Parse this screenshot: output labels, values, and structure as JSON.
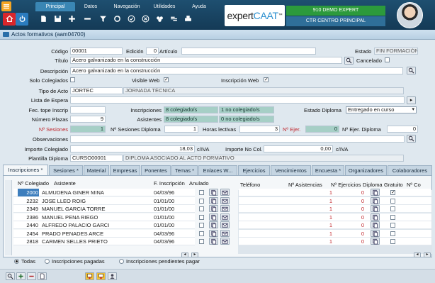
{
  "menu": {
    "tabs": [
      "Principal",
      "Datos",
      "Navegación",
      "Utilidades",
      "Ayuda"
    ],
    "active_tab": "Principal",
    "toolbar_icons": [
      "home-icon",
      "new-document-icon",
      "save-icon",
      "add-icon",
      "delete-icon",
      "filter-icon",
      "refresh-icon",
      "check-icon",
      "close-icon",
      "group-icon",
      "link-icon",
      "print-icon"
    ]
  },
  "brand": {
    "logo_part1": "expert",
    "logo_part2": "CAAT",
    "logo_trademark": "™"
  },
  "user": {
    "company": "910 DEMO EXPERT",
    "center": "CTR CENTRO PRINCIPAL"
  },
  "window": {
    "title": "Actos formativos (aam04700)"
  },
  "form": {
    "codigo_label": "Código",
    "codigo_value": "00001",
    "edicion_label": "Edición",
    "edicion_value": "0",
    "articulo_label": "Artículo",
    "articulo_value": "",
    "estado_label": "Estado",
    "estado_value": "FIN FORMACIÓN",
    "titulo_label": "Título",
    "titulo_value": "Acero galvanizado en la construcción",
    "cancelado_label": "Cancelado",
    "descripcion_label": "Descripción",
    "descripcion_value": "Acero galvanizado en la construcción",
    "solo_colegiados_label": "Solo Colegiados",
    "visible_web_label": "Visible Web",
    "inscripcion_web_label": "Inscripción Web",
    "tipo_acto_label": "Tipo de Acto",
    "tipo_acto_code": "JORTEC",
    "tipo_acto_desc": "JORNADA TÉCNICA",
    "lista_espera_label": "Lista de Espera",
    "fec_tope_label": "Fec. tope Inscrip",
    "inscripciones_label": "Inscripciones",
    "inscripciones_col": "8 colegiado/s",
    "inscripciones_nocol": "1 no colegiado/s",
    "estado_diploma_label": "Estado Diploma",
    "estado_diploma_value": "Entregado en curso",
    "numero_plazas_label": "Número Plazas",
    "numero_plazas_value": "9",
    "asistentes_label": "Asistentes",
    "asistentes_col": "8 colegiado/s",
    "asistentes_nocol": "0 no colegiado/s",
    "n_sesiones_label": "Nº Sesiones",
    "n_sesiones_value": "1",
    "n_sesiones_diploma_label": "Nº Sesiones Diploma",
    "n_sesiones_diploma_value": "1",
    "horas_lectivas_label": "Horas lectivas",
    "horas_lectivas_value": "3",
    "n_ejer_label": "Nº Ejer.",
    "n_ejer_value": "0",
    "n_ejer_diploma_label": "Nº Ejer. Diploma",
    "n_ejer_diploma_value": "0",
    "observaciones_label": "Observaciones",
    "importe_colegiado_label": "Importe Colegiado",
    "importe_colegiado_value": "18,03",
    "importe_colegiado_iva": "c/IVA",
    "importe_nocol_label": "Importe No Col.",
    "importe_nocol_value": "0,00",
    "importe_nocol_iva": "c/IVA",
    "plantilla_label": "Plantilla Diploma",
    "plantilla_code": "CURSO00001",
    "plantilla_desc": "DIPLOMA ASOCIADO AL ACTO FORMATIVO"
  },
  "tabs": [
    "Inscripciones *",
    "Sesiones *",
    "Material",
    "Empresas",
    "Ponentes",
    "Temas *",
    "Enlaces W...",
    "Ejercicios",
    "Vencimientos",
    "Encuesta *",
    "Organizadores",
    "Colaboradores"
  ],
  "grid": {
    "columns": {
      "colegiado": "Nº Colegiado",
      "asistente": "Asistente",
      "f_inscripcion": "F. Inscripción",
      "anulado": "Anulado",
      "telefono": "Teléfono",
      "n_asistencias": "Nº Asistencias",
      "n_ejercicios": "Nº Ejercicios",
      "diploma": "Diploma",
      "gratuito": "Gratuito",
      "n_co": "Nº Co"
    },
    "rows": [
      {
        "colegiado": "2000",
        "asistente": "ALMUDENA GINER MINA",
        "fecha": "04/03/96",
        "asistencias": "1",
        "ejercicios": "0",
        "gratuito": true
      },
      {
        "colegiado": "2232",
        "asistente": "JOSE LLEO ROIG",
        "fecha": "01/01/00",
        "asistencias": "1",
        "ejercicios": "0",
        "gratuito": false
      },
      {
        "colegiado": "2349",
        "asistente": "MANUEL GARCIA TORRE",
        "fecha": "01/01/00",
        "asistencias": "1",
        "ejercicios": "0",
        "gratuito": false
      },
      {
        "colegiado": "2386",
        "asistente": "MANUEL PENA RIEGO",
        "fecha": "01/01/00",
        "asistencias": "1",
        "ejercicios": "0",
        "gratuito": false
      },
      {
        "colegiado": "2440",
        "asistente": "ALFREDO PALACIO GARCI",
        "fecha": "01/01/00",
        "asistencias": "1",
        "ejercicios": "0",
        "gratuito": false
      },
      {
        "colegiado": "2454",
        "asistente": "PRADO PENADES ARCE",
        "fecha": "04/03/96",
        "asistencias": "1",
        "ejercicios": "0",
        "gratuito": false
      },
      {
        "colegiado": "2818",
        "asistente": "CARMEN SELLES PRIETO",
        "fecha": "04/03/96",
        "asistencias": "1",
        "ejercicios": "0",
        "gratuito": false
      }
    ]
  },
  "filters": {
    "todas": "Todas",
    "pagadas": "Inscripciones pagadas",
    "pendientes": "Inscripciones pendientes pagar"
  },
  "colors": {
    "topbar": "#1e4f70",
    "accent": "#3a86b4",
    "green_badge": "#2c9a3c",
    "value_green": "#a6cfc6",
    "red_text": "#c0272d"
  }
}
